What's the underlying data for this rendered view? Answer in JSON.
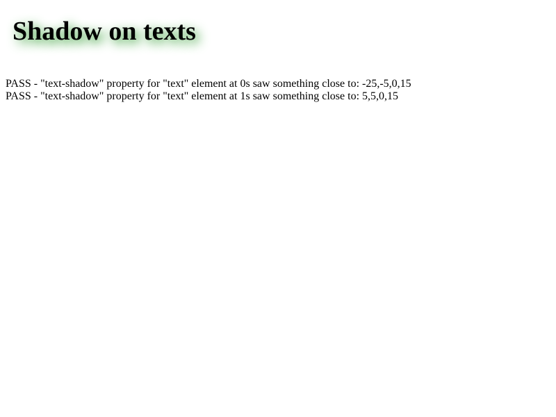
{
  "heading": "Shadow on texts",
  "colors": {
    "shadow": "#2e9a2e",
    "text": "#000000",
    "background": "#ffffff"
  },
  "results": [
    "PASS - \"text-shadow\" property for \"text\" element at 0s saw something close to: -25,-5,0,15",
    "PASS - \"text-shadow\" property for \"text\" element at 1s saw something close to: 5,5,0,15"
  ]
}
